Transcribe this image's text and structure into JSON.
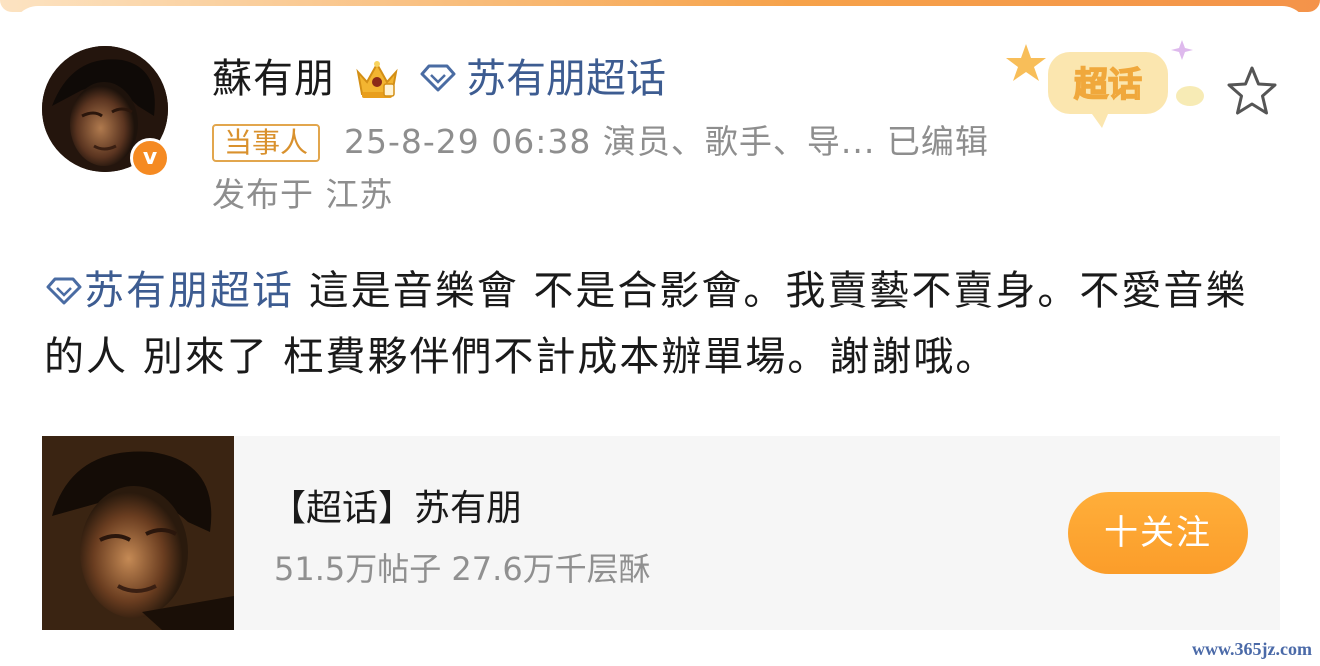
{
  "author": {
    "name": "蘇有朋",
    "topic_link": "苏有朋超话",
    "tag": "当事人",
    "meta": "25-8-29 06:38  演员、歌手、导... 已编辑",
    "location": "发布于 江苏",
    "verified_mark": "v"
  },
  "badge": {
    "label": "超话"
  },
  "post": {
    "topic": "苏有朋超话",
    "text": " 這是音樂會 不是合影會。我賣藝不賣身。不愛音樂的人 別來了 枉費夥伴們不計成本辦單場。謝謝哦。"
  },
  "topic_card": {
    "title": "【超话】苏有朋",
    "stats": "51.5万帖子 27.6万千层酥",
    "follow_label": "十关注"
  },
  "watermark": "www.365jz.com",
  "colors": {
    "link": "#3d5c91",
    "accent": "#fb9d2a",
    "tag": "#d9912d",
    "muted": "#8e8e8e"
  },
  "icons": [
    "crown-icon",
    "diamond-icon",
    "star-icon",
    "verified-icon"
  ]
}
